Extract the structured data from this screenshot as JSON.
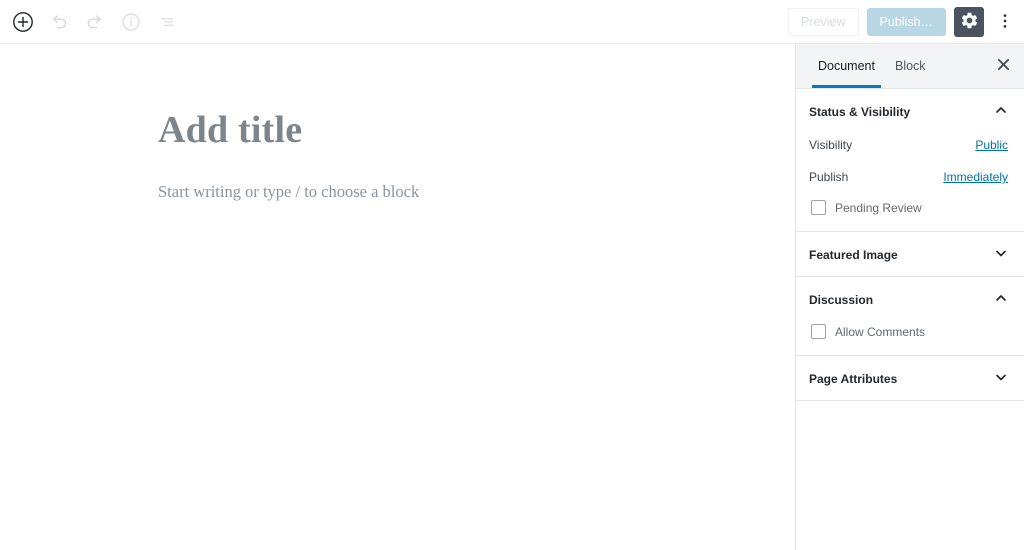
{
  "toolbar": {
    "add_block_icon": "circle-plus-icon",
    "undo_icon": "undo-icon",
    "redo_icon": "redo-icon",
    "info_icon": "info-icon",
    "outline_icon": "list-view-icon",
    "preview_label": "Preview",
    "publish_label": "Publish…",
    "settings_icon": "gear-icon",
    "more_icon": "kebab-menu-icon"
  },
  "canvas": {
    "title_placeholder": "Add title",
    "body_placeholder": "Start writing or type / to choose a block"
  },
  "sidebar": {
    "tabs": [
      {
        "label": "Document",
        "active": true
      },
      {
        "label": "Block",
        "active": false
      }
    ],
    "close_icon": "close-icon",
    "panels": [
      {
        "title": "Status & Visibility",
        "expanded": true,
        "toggle_icon": "chevron-up-icon",
        "rows": [
          {
            "label": "Visibility",
            "value": "Public"
          },
          {
            "label": "Publish",
            "value": "Immediately"
          }
        ],
        "checkboxes": [
          {
            "label": "Pending Review",
            "checked": false
          }
        ]
      },
      {
        "title": "Featured Image",
        "expanded": false,
        "toggle_icon": "chevron-down-icon",
        "rows": [],
        "checkboxes": []
      },
      {
        "title": "Discussion",
        "expanded": true,
        "toggle_icon": "chevron-up-icon",
        "rows": [],
        "checkboxes": [
          {
            "label": "Allow Comments",
            "checked": false
          }
        ]
      },
      {
        "title": "Page Attributes",
        "expanded": false,
        "toggle_icon": "chevron-down-icon",
        "rows": [],
        "checkboxes": []
      }
    ]
  },
  "colors": {
    "accent": "#007cba",
    "link": "#0073aa",
    "publish_button": "#b9d6e4",
    "gear_button": "#4a535f",
    "border": "#e2e4e7"
  }
}
